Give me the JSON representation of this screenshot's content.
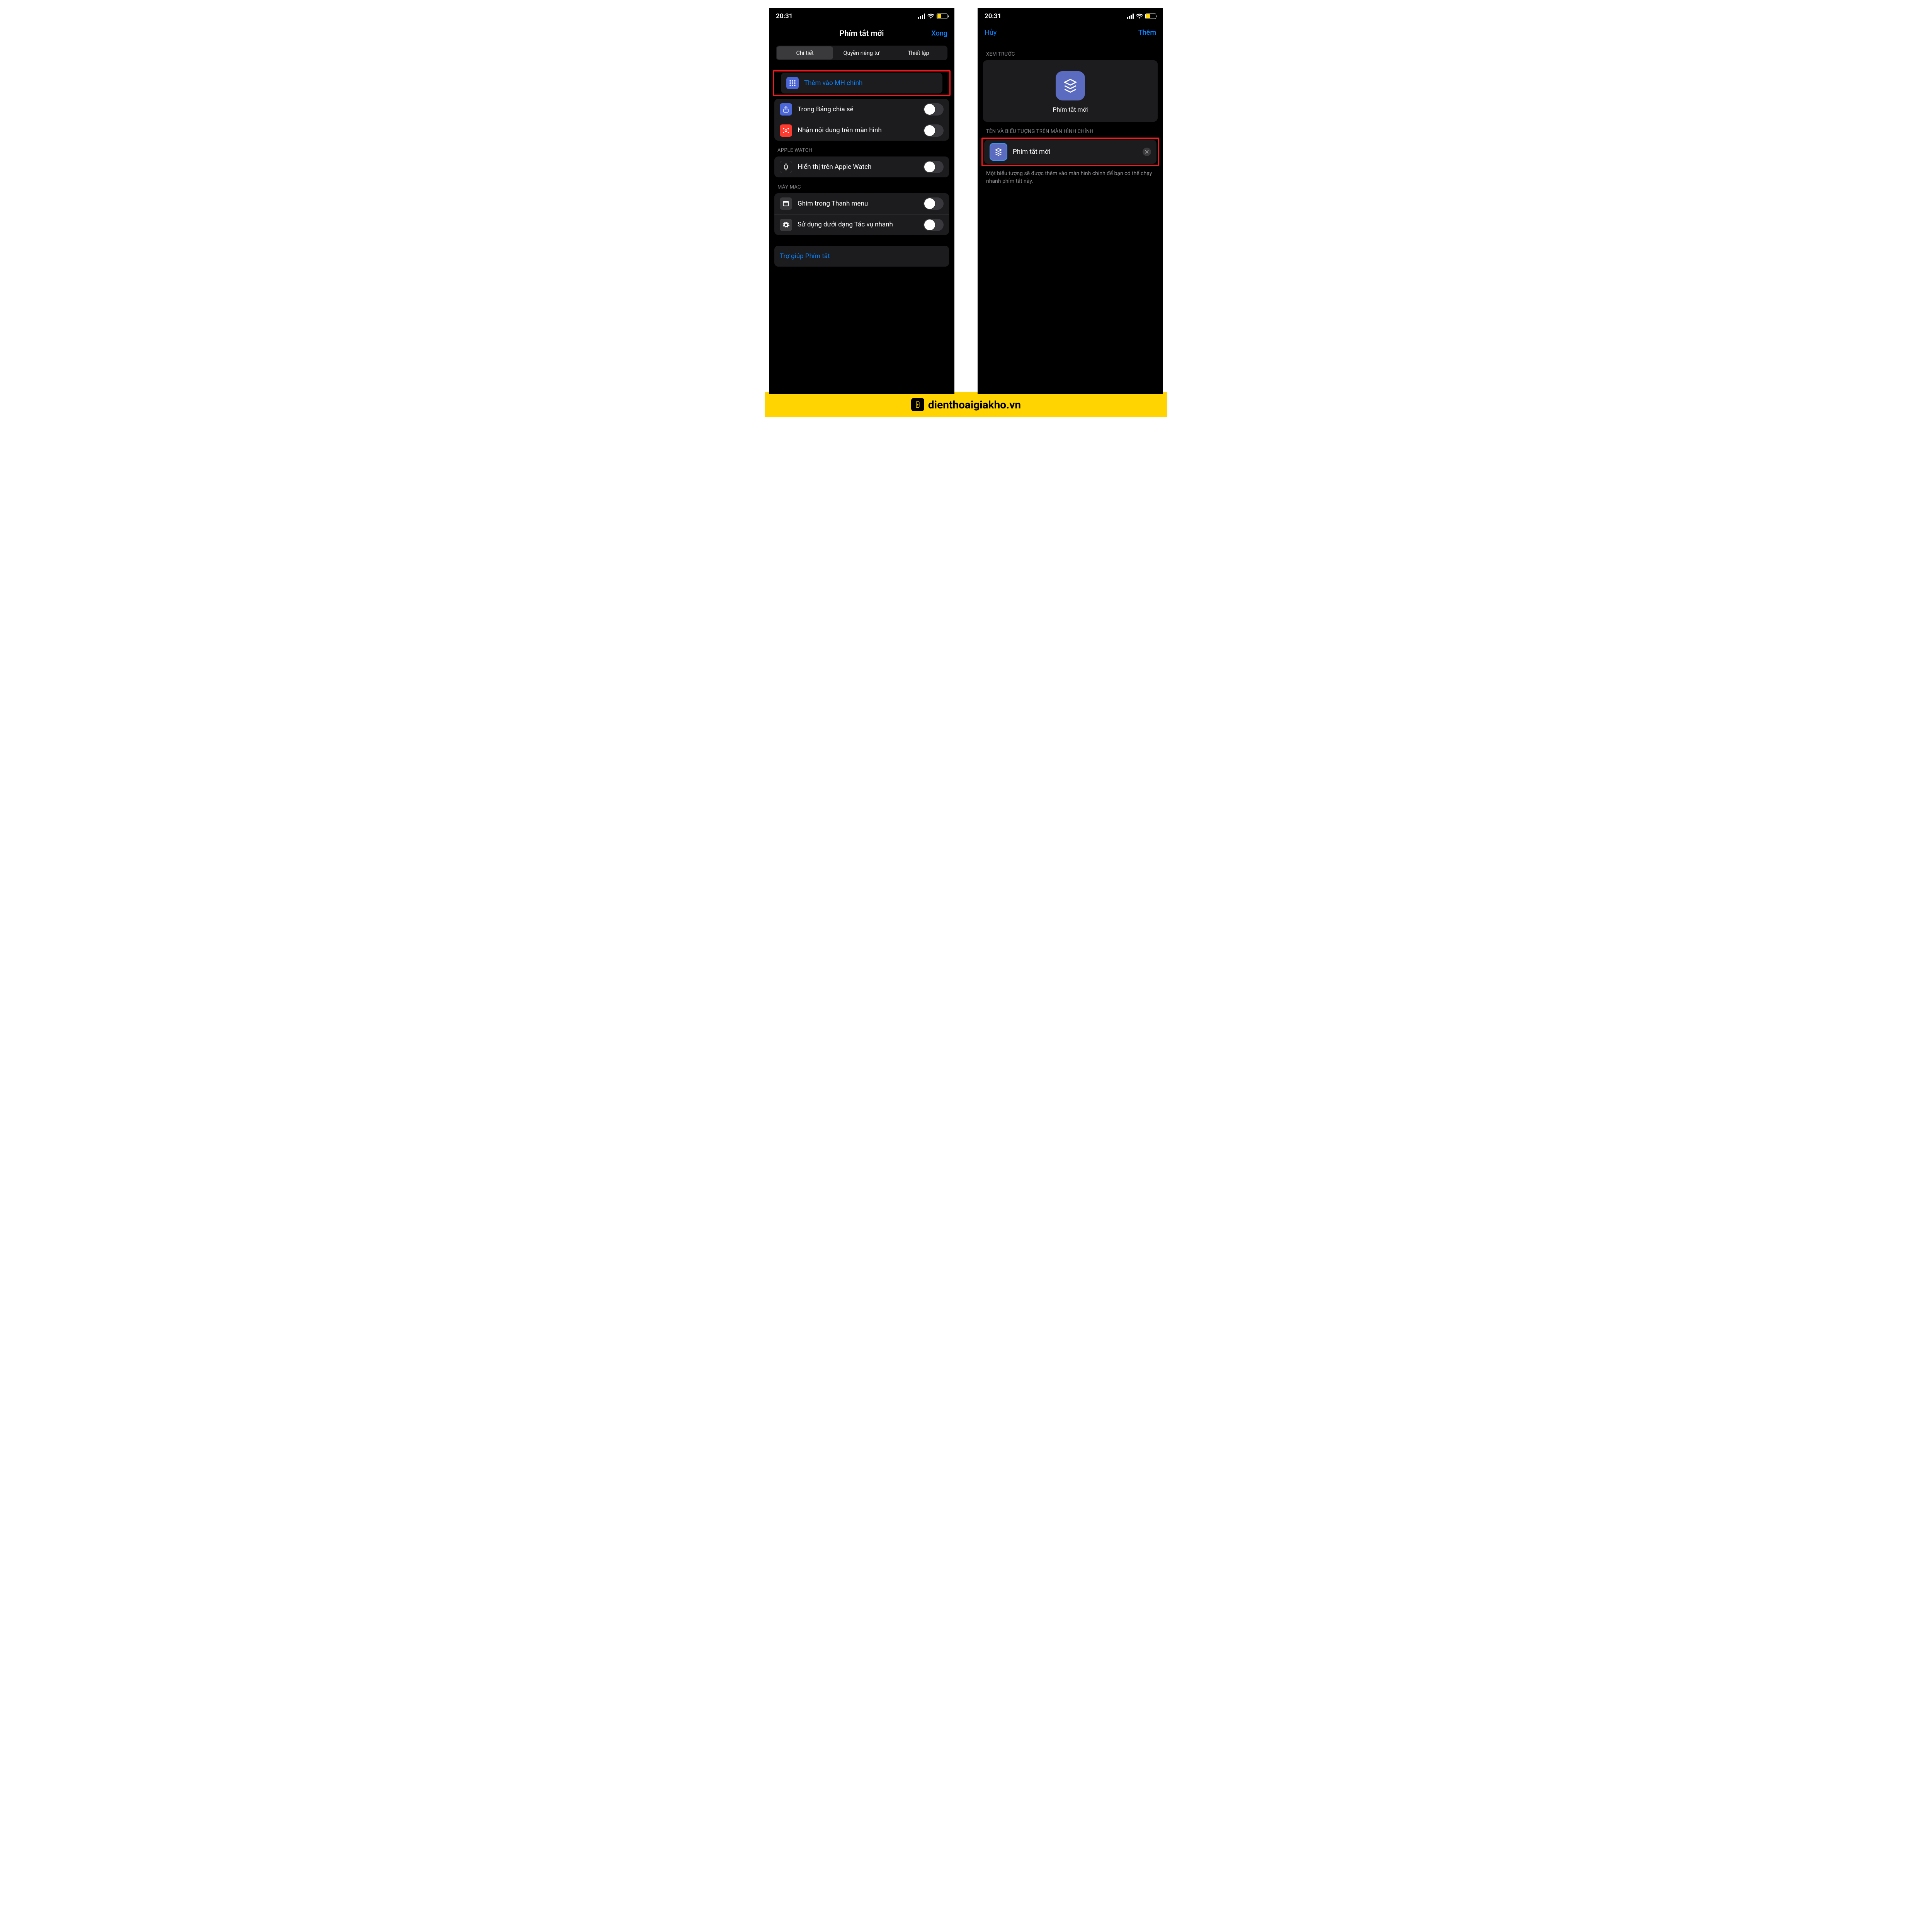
{
  "status": {
    "time": "20:31"
  },
  "left": {
    "nav": {
      "title": "Phím tắt mới",
      "done": "Xong"
    },
    "tabs": [
      "Chi tiết",
      "Quyền riêng tư",
      "Thiết lập"
    ],
    "rows": {
      "addHome": "Thêm vào MH chính",
      "shareSheet": "Trong Bảng chia sẻ",
      "receiveScreen": "Nhận nội dung trên màn hình"
    },
    "sections": {
      "watch": "APPLE WATCH",
      "watchRow": "Hiển thị trên Apple Watch",
      "mac": "MÁY MAC",
      "pinMenu": "Ghim trong Thanh menu",
      "quickAction": "Sử dụng dưới dạng Tác vụ nhanh"
    },
    "help": "Trợ giúp Phím tắt"
  },
  "right": {
    "nav": {
      "cancel": "Hủy",
      "add": "Thêm"
    },
    "previewHeader": "XEM TRƯỚC",
    "previewLabel": "Phím tắt mới",
    "nameHeader": "TÊN VÀ BIỂU TƯỢNG TRÊN MÀN HÌNH CHÍNH",
    "nameValue": "Phím tắt mới",
    "helper": "Một biểu tượng sẽ được thêm vào màn hình chính để bạn có thể chạy nhanh phím tắt này."
  },
  "banner": "dienthoaigiakho.vn",
  "icons": {
    "shortcutIcon": "shortcut-layers-icon",
    "appGrid": "app-grid-icon",
    "share": "share-icon",
    "capture": "capture-icon",
    "watch": "watch-icon",
    "window": "window-icon",
    "gear": "gear-icon"
  }
}
